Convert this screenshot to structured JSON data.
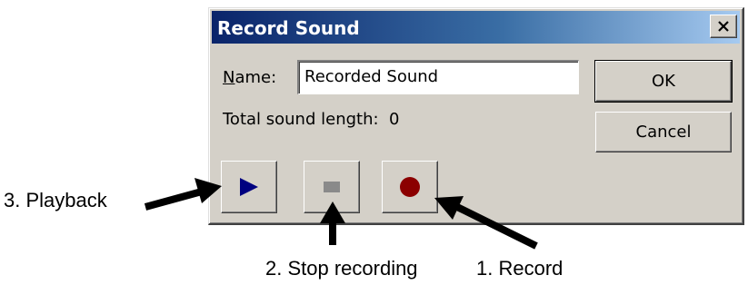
{
  "dialog": {
    "title": "Record Sound",
    "close_symbol": "×",
    "name_label_mnemonic": "N",
    "name_label_rest": "ame:",
    "name_value": "Recorded Sound",
    "length_label": "Total sound length:",
    "length_value": "0",
    "ok_label": "OK",
    "cancel_label": "Cancel",
    "controls": {
      "play_icon": "play-icon",
      "stop_icon": "stop-icon",
      "record_icon": "record-icon"
    }
  },
  "annotations": {
    "playback": "3. Playback",
    "stop": "2. Stop recording",
    "record": "1. Record"
  },
  "colors": {
    "title_bar_start": "#0a246a",
    "title_bar_end": "#a6caf0",
    "dialog_face": "#d4d0c8",
    "play_glyph": "#000080",
    "stop_glyph": "#8a8a8a",
    "record_glyph": "#8b0000"
  }
}
